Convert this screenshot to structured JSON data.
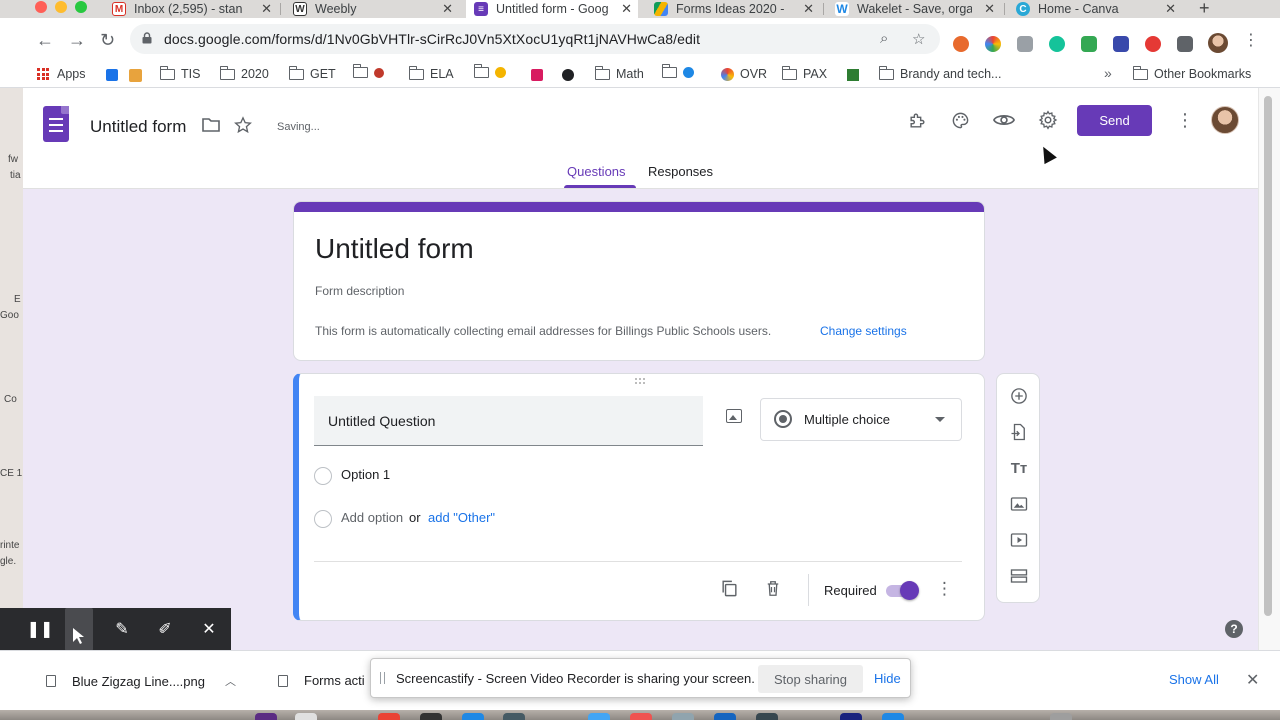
{
  "browser": {
    "tabs": [
      {
        "title": "Inbox (2,595) - stan",
        "favicon": "gmail-icon"
      },
      {
        "title": "Weebly",
        "favicon": "weebly-icon"
      },
      {
        "title": "Untitled form - Goog",
        "favicon": "google-forms-icon",
        "active": true
      },
      {
        "title": "Forms Ideas 2020 -",
        "favicon": "google-drive-icon"
      },
      {
        "title": "Wakelet - Save, orga",
        "favicon": "wakelet-icon"
      },
      {
        "title": "Home - Canva",
        "favicon": "canva-icon"
      }
    ],
    "url": "docs.google.com/forms/d/1Nv0GbVHTlr-sCirRcJ0Vn5XtXocU1yqRt1jNAVHwCa8/edit",
    "bookmarks": [
      "Apps",
      "TIS",
      "2020",
      "GET",
      "ELA",
      "Math",
      "OVR",
      "PAX",
      "Brandy and tech...",
      "Other Bookmarks"
    ],
    "bookmarks_overflow": "»"
  },
  "form": {
    "app_title": "Untitled form",
    "status": "Saving...",
    "send_label": "Send",
    "tabs": {
      "questions": "Questions",
      "responses": "Responses"
    },
    "title": "Untitled form",
    "description_placeholder": "Form description",
    "email_notice": "This form is automatically collecting email addresses for Billings Public Schools users.",
    "change_settings": "Change settings",
    "question": {
      "title": "Untitled Question",
      "type": "Multiple choice",
      "options": [
        "Option 1"
      ],
      "add_option": "Add option",
      "or": "or",
      "add_other": "add \"Other\"",
      "required_label": "Required",
      "required": true
    },
    "accent": "#673ab7",
    "background": "#ede7f6"
  },
  "downloads": {
    "items": [
      "Blue Zigzag Line....png",
      "Forms acti"
    ],
    "show_all": "Show All"
  },
  "screen_share": {
    "message": "Screencastify - Screen Video Recorder is sharing your screen.",
    "stop": "Stop sharing",
    "hide": "Hide"
  },
  "left_strip_text": [
    "fw",
    "tia",
    "E",
    "Goo",
    "Co",
    "CE 1",
    "rinte",
    "gle."
  ]
}
